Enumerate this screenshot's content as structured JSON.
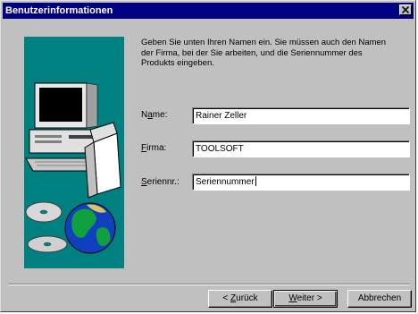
{
  "window": {
    "title": "Benutzerinformationen",
    "close_glyph": "×",
    "colors": {
      "titlebar": "#000080",
      "face": "#c0c0c0",
      "panel": "#008080"
    }
  },
  "illustration": {
    "icon": "computer-with-disks-and-globe"
  },
  "intro": {
    "line1": "Geben Sie unten Ihren Namen ein. Sie müssen auch den Namen",
    "line2": "der Firma, bei der Sie arbeiten, und die Seriennummer des",
    "line3": "Produkts eingeben."
  },
  "fields": {
    "name": {
      "label_pre": "N",
      "label_access": "a",
      "label_post": "me:",
      "value": "Rainer Zeller"
    },
    "firma": {
      "label_pre": "",
      "label_access": "F",
      "label_post": "irma:",
      "value": "TOOLSOFT"
    },
    "serien": {
      "label_pre": "",
      "label_access": "S",
      "label_post": "eriennr.:",
      "value": "Seriennummer"
    }
  },
  "buttons": {
    "back": {
      "pre": "< ",
      "access": "Z",
      "post": "urück"
    },
    "next": {
      "pre": "",
      "access": "W",
      "post": "eiter >"
    },
    "cancel": {
      "label": "Abbrechen"
    }
  }
}
